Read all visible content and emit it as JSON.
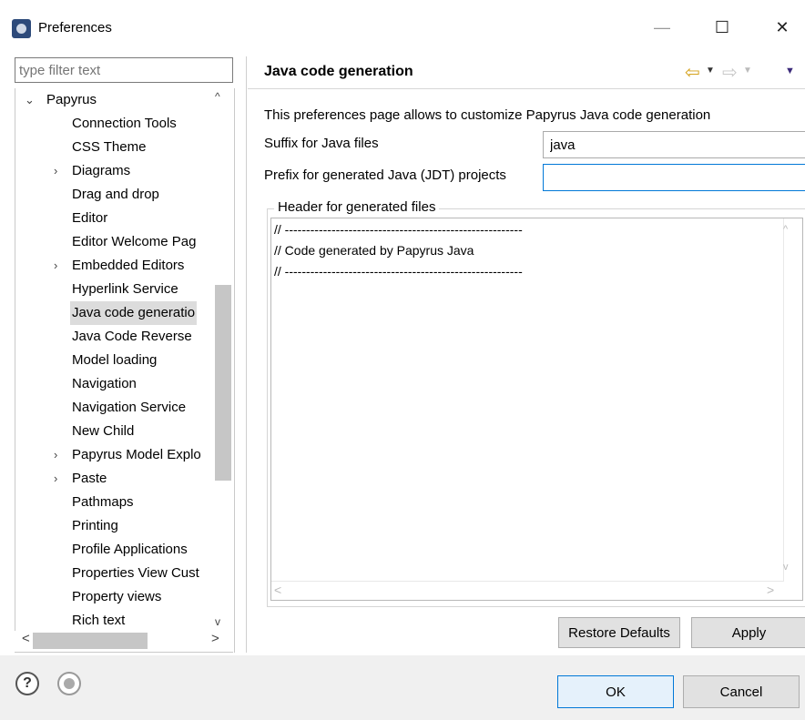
{
  "window": {
    "title": "Preferences",
    "controls": {
      "minimize": "—",
      "maximize": "☐",
      "close": "✕"
    }
  },
  "filter": {
    "placeholder": "type filter text"
  },
  "tree": {
    "items": [
      {
        "label": "Papyrus",
        "arrow": "⌄",
        "level": 0
      },
      {
        "label": "Connection Tools",
        "arrow": "",
        "level": 1
      },
      {
        "label": "CSS Theme",
        "arrow": "",
        "level": 1
      },
      {
        "label": "Diagrams",
        "arrow": "›",
        "level": 1
      },
      {
        "label": "Drag and drop",
        "arrow": "",
        "level": 1
      },
      {
        "label": "Editor",
        "arrow": "",
        "level": 1
      },
      {
        "label": "Editor Welcome Pag",
        "arrow": "",
        "level": 1
      },
      {
        "label": "Embedded Editors",
        "arrow": "›",
        "level": 1
      },
      {
        "label": "Hyperlink Service",
        "arrow": "",
        "level": 1
      },
      {
        "label": "Java code generatio",
        "arrow": "",
        "level": 1,
        "selected": true
      },
      {
        "label": "Java Code Reverse",
        "arrow": "",
        "level": 1
      },
      {
        "label": "Model loading",
        "arrow": "",
        "level": 1
      },
      {
        "label": "Navigation",
        "arrow": "",
        "level": 1
      },
      {
        "label": "Navigation Service",
        "arrow": "",
        "level": 1
      },
      {
        "label": "New Child",
        "arrow": "",
        "level": 1
      },
      {
        "label": "Papyrus Model Explo",
        "arrow": "›",
        "level": 1
      },
      {
        "label": "Paste",
        "arrow": "›",
        "level": 1
      },
      {
        "label": "Pathmaps",
        "arrow": "",
        "level": 1
      },
      {
        "label": "Printing",
        "arrow": "",
        "level": 1
      },
      {
        "label": "Profile Applications",
        "arrow": "",
        "level": 1
      },
      {
        "label": "Properties View Cust",
        "arrow": "",
        "level": 1
      },
      {
        "label": "Property views",
        "arrow": "",
        "level": 1
      },
      {
        "label": "Rich text",
        "arrow": "",
        "level": 1
      }
    ],
    "scroll": {
      "up": "^",
      "down": "v",
      "left": "<",
      "right": ">"
    }
  },
  "page": {
    "title": "Java code generation",
    "description": "This preferences page allows to customize Papyrus Java code generation",
    "suffix": {
      "label": "Suffix for Java files",
      "value": "java"
    },
    "prefix": {
      "label": "Prefix for generated Java (JDT) projects",
      "value": ""
    },
    "header": {
      "legend": "Header for generated files",
      "lines": [
        "// --------------------------------------------------------",
        "// Code generated by Papyrus Java",
        "// --------------------------------------------------------"
      ]
    },
    "nav": {
      "back": "⇦",
      "forward": "⇨",
      "dropdown": "▼",
      "menu": "▼"
    }
  },
  "buttons": {
    "restore_defaults": "Restore Defaults",
    "apply": "Apply",
    "ok": "OK",
    "cancel": "Cancel"
  },
  "footer": {
    "help": "?"
  }
}
